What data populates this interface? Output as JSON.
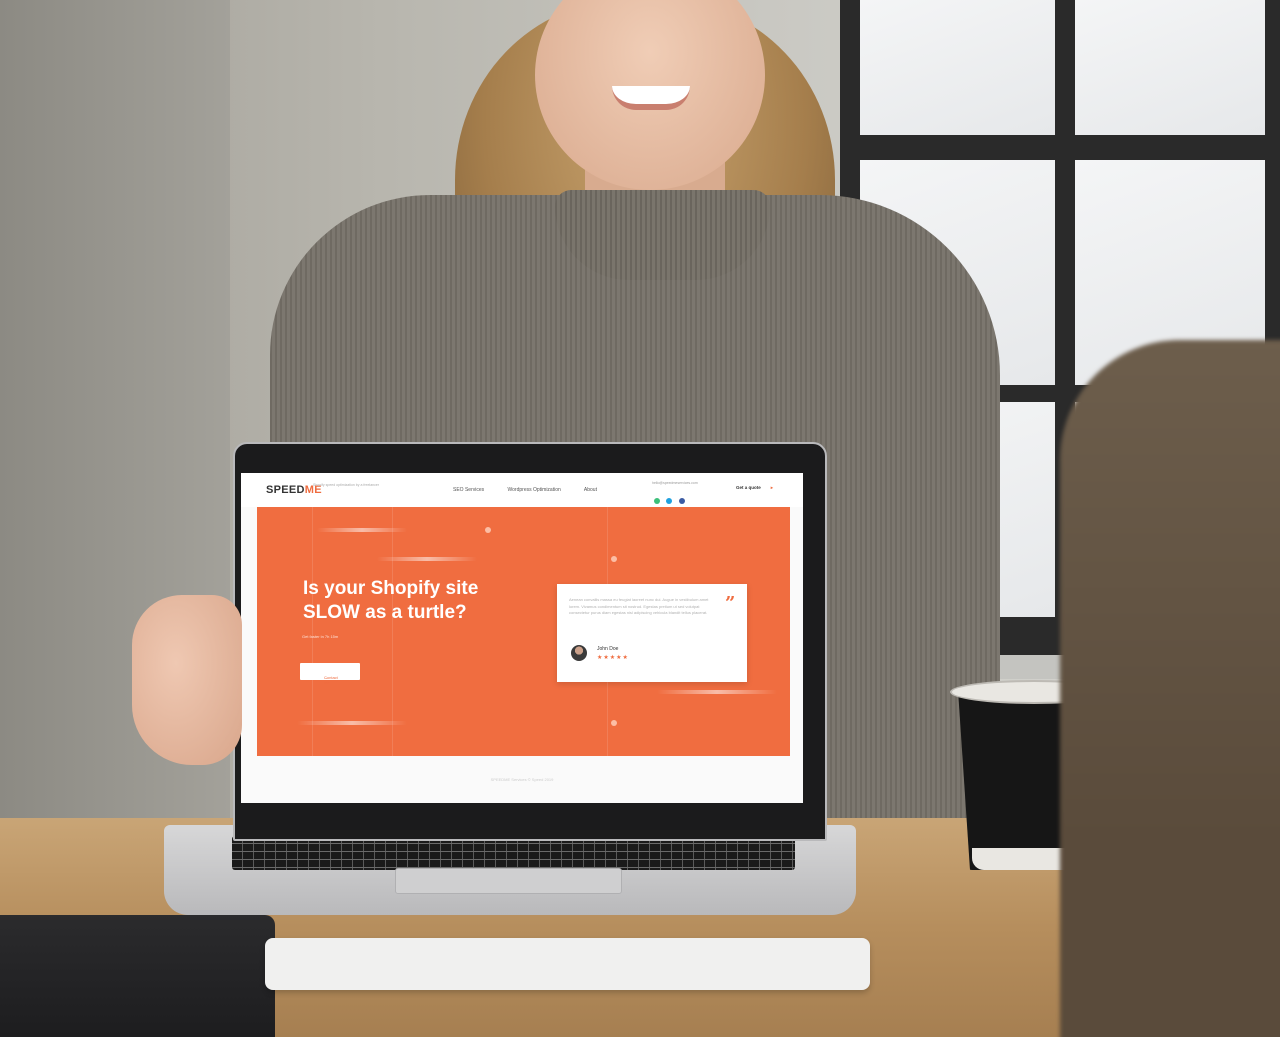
{
  "site": {
    "logo_main": "SPEED",
    "logo_accent": "ME",
    "tagline": "Shopify speed optimization by a freelancer",
    "menu": [
      "SEO Services",
      "Wordpress Optimization",
      "About"
    ],
    "contact_email": "hello@speedmeservices.com",
    "quote_button": "Get a quote",
    "quote_arrow": "▸"
  },
  "hero": {
    "headline": "Is your Shopify site SLOW as a turtle?",
    "subline": "Get faster in 7h 15m",
    "cta_label": "Contact me",
    "cta_arrow": "→"
  },
  "testimonial": {
    "text": "Aenean convallis massa eu feugiat laoreet nunc dui. Augue in vestibulum amet lorem. Vivamus condimentum sit nostrud. Egestas pretium ut sed volutpat consectetur purus diam egestas nisl adipiscing vehicula blandit tellus placerat.",
    "quote_mark": "”",
    "author": "John Doe",
    "stars": "★★★★★",
    "rating": 5
  },
  "footer": {
    "copyright": "SPEEDME Services © Speed 2019"
  },
  "colors": {
    "brand": "#f06d40",
    "social": [
      "#3cc07a",
      "#1fa1e0",
      "#3b5ba3"
    ]
  }
}
